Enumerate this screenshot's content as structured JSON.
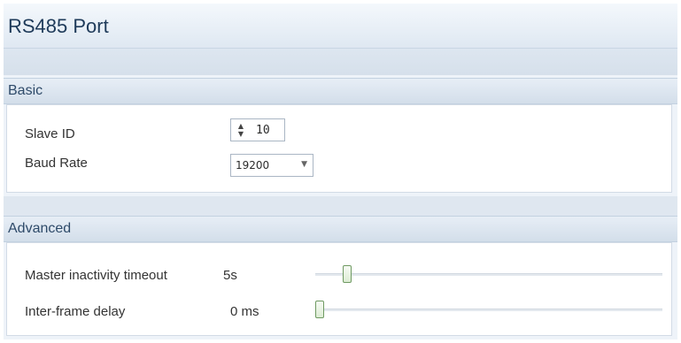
{
  "page": {
    "title": "RS485 Port"
  },
  "basic": {
    "header": "Basic",
    "slave_id": {
      "label": "Slave ID",
      "value": "10"
    },
    "baud_rate": {
      "label": "Baud Rate",
      "value": "19200"
    }
  },
  "advanced": {
    "header": "Advanced",
    "master_timeout": {
      "label": "Master inactivity timeout",
      "value": "5s",
      "slider_fraction": 0.08
    },
    "inter_frame_delay": {
      "label": "Inter-frame delay",
      "value": "0 ms",
      "slider_fraction": 0.0
    }
  },
  "icons": {
    "stepper": "up-down-arrows-icon",
    "dropdown": "chevron-down-icon",
    "slider_thumb": "slider-thumb"
  },
  "colors": {
    "header_bg": "#dfe8f2",
    "title_text": "#1f3b5a",
    "slider_thumb_border": "#6f9a62"
  }
}
